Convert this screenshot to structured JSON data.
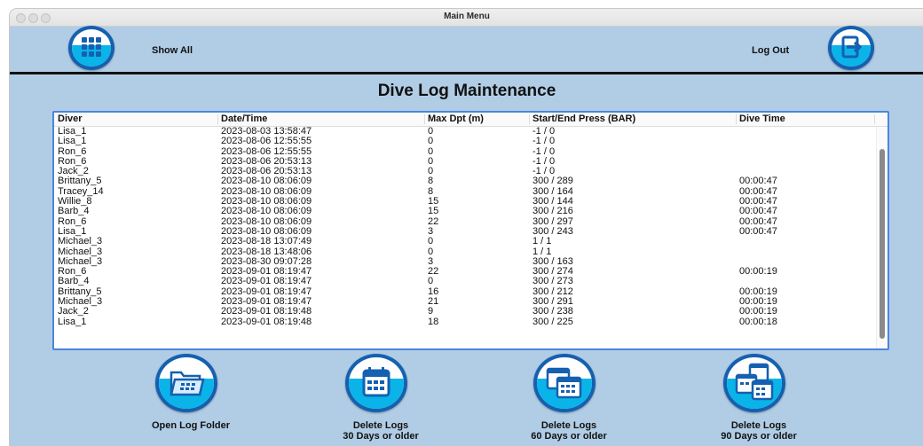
{
  "window": {
    "title": "Main Menu"
  },
  "toolbar": {
    "show_all_label": "Show All",
    "logout_label": "Log Out"
  },
  "page": {
    "heading": "Dive Log Maintenance"
  },
  "table": {
    "columns": [
      "Diver",
      "Date/Time",
      "Max Dpt (m)",
      "Start/End Press (BAR)",
      "Dive Time"
    ],
    "rows": [
      [
        "Lisa_1",
        "2023-08-03 13:58:47",
        "0",
        "-1 / 0",
        ""
      ],
      [
        "Lisa_1",
        "2023-08-06 12:55:55",
        "0",
        "-1 / 0",
        ""
      ],
      [
        "Ron_6",
        "2023-08-06 12:55:55",
        "0",
        "-1 / 0",
        ""
      ],
      [
        "Ron_6",
        "2023-08-06 20:53:13",
        "0",
        "-1 / 0",
        ""
      ],
      [
        "Jack_2",
        "2023-08-06 20:53:13",
        "0",
        "-1 / 0",
        ""
      ],
      [
        "Brittany_5",
        "2023-08-10 08:06:09",
        "8",
        "300 / 289",
        "00:00:47"
      ],
      [
        "Tracey_14",
        "2023-08-10 08:06:09",
        "8",
        "300 / 164",
        "00:00:47"
      ],
      [
        "Willie_8",
        "2023-08-10 08:06:09",
        "15",
        "300 / 144",
        "00:00:47"
      ],
      [
        "Barb_4",
        "2023-08-10 08:06:09",
        "15",
        "300 / 216",
        "00:00:47"
      ],
      [
        "Ron_6",
        "2023-08-10 08:06:09",
        "22",
        "300 / 297",
        "00:00:47"
      ],
      [
        "Lisa_1",
        "2023-08-10 08:06:09",
        "3",
        "300 / 243",
        "00:00:47"
      ],
      [
        "Michael_3",
        "2023-08-18 13:07:49",
        "0",
        "1 / 1",
        ""
      ],
      [
        "Michael_3",
        "2023-08-18 13:48:06",
        "0",
        "1 / 1",
        ""
      ],
      [
        "Michael_3",
        "2023-08-30 09:07:28",
        "3",
        "300 / 163",
        ""
      ],
      [
        "Ron_6",
        "2023-09-01 08:19:47",
        "22",
        "300 / 274",
        "00:00:19"
      ],
      [
        "Barb_4",
        "2023-09-01 08:19:47",
        "0",
        "300 / 273",
        ""
      ],
      [
        "Brittany_5",
        "2023-09-01 08:19:47",
        "16",
        "300 / 212",
        "00:00:19"
      ],
      [
        "Michael_3",
        "2023-09-01 08:19:47",
        "21",
        "300 / 291",
        "00:00:19"
      ],
      [
        "Jack_2",
        "2023-09-01 08:19:48",
        "9",
        "300 / 238",
        "00:00:19"
      ],
      [
        "Lisa_1",
        "2023-09-01 08:19:48",
        "18",
        "300 / 225",
        "00:00:18"
      ]
    ]
  },
  "actions": {
    "open_folder": {
      "label_1": "Open Log Folder",
      "icon": "folder-calendar-icon"
    },
    "delete_30": {
      "label_1": "Delete Logs",
      "label_2": "30 Days or older",
      "icon": "calendar-icon"
    },
    "delete_60": {
      "label_1": "Delete Logs",
      "label_2": "60 Days or older",
      "icon": "two-calendars-icon"
    },
    "delete_90": {
      "label_1": "Delete Logs",
      "label_2": "90 Days or older",
      "icon": "three-calendars-icon"
    }
  },
  "colors": {
    "background": "#b1cde6",
    "icon_ring": "#1560b0",
    "icon_water": "#0ab4e8",
    "table_border": "#4a86d9"
  }
}
